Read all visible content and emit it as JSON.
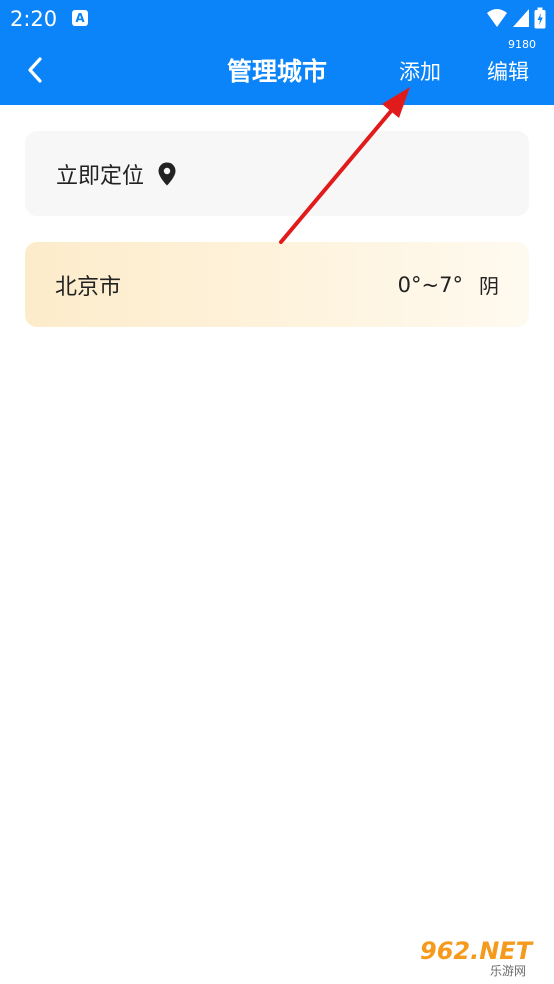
{
  "status_bar": {
    "time": "2:20",
    "app_icon": "A",
    "version": "9180"
  },
  "toolbar": {
    "title": "管理城市",
    "add_label": "添加",
    "edit_label": "编辑"
  },
  "locate": {
    "label": "立即定位"
  },
  "cities": [
    {
      "name": "北京市",
      "temp": "0°~7°",
      "weather": "阴"
    }
  ],
  "watermark": {
    "text": "962.NET",
    "sub": "乐游网"
  },
  "colors": {
    "header": "#0b84f9",
    "arrow": "#e11b1b",
    "locate_bg": "#f7f7f7",
    "city_bg": "#fdeccb"
  }
}
